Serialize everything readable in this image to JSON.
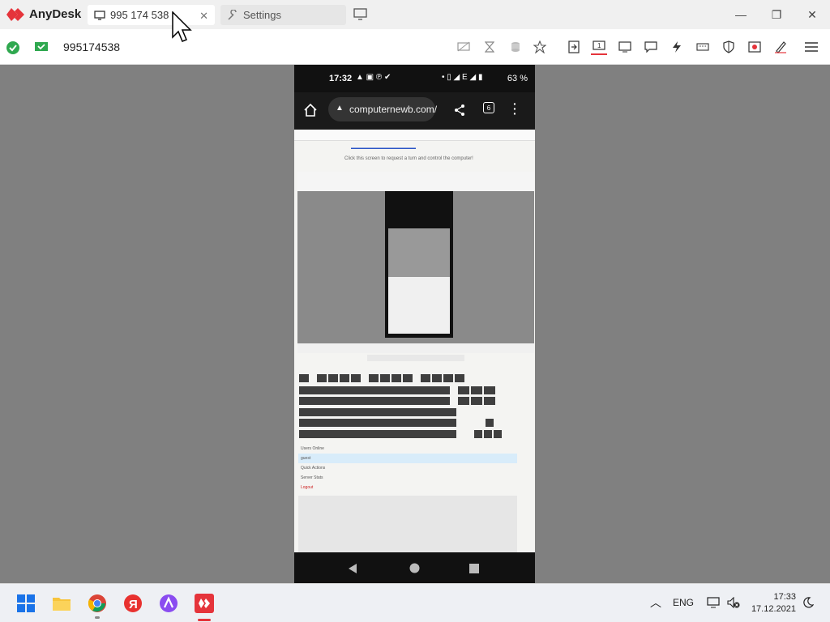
{
  "app": {
    "name": "AnyDesk",
    "brand_color": "#e5343b"
  },
  "tabs": [
    {
      "label": "995 174 538",
      "icon": "monitor-icon",
      "active": true
    },
    {
      "label": "Settings",
      "icon": "wrench-icon",
      "active": false
    }
  ],
  "address": {
    "value": "995174538"
  },
  "remote": {
    "status_time": "17:32",
    "battery": "63 %",
    "url": "computernewb.com/",
    "tab_count": "6",
    "page_hint": "Click this screen to request a turn and control the computer!",
    "menu": [
      "Users Online",
      "guest",
      "Quick Actions",
      "Server Stats",
      "Logout"
    ]
  },
  "taskbar": {
    "language": "ENG",
    "time": "17:33",
    "date": "17.12.2021"
  }
}
